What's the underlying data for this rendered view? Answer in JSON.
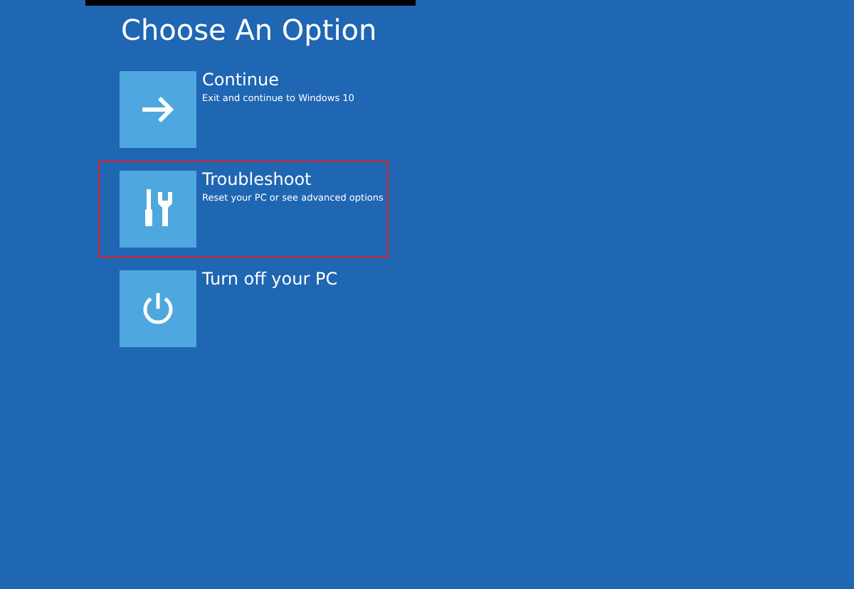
{
  "title": "Choose An Option",
  "options": [
    {
      "kind": "continue",
      "label": "Continue",
      "description": "Exit and continue to Windows 10",
      "selected": false
    },
    {
      "kind": "troubleshoot",
      "label": "Troubleshoot",
      "description": "Reset your PC or see advanced options",
      "selected": true
    },
    {
      "kind": "power",
      "label": "Turn off your PC",
      "selected": false
    }
  ]
}
